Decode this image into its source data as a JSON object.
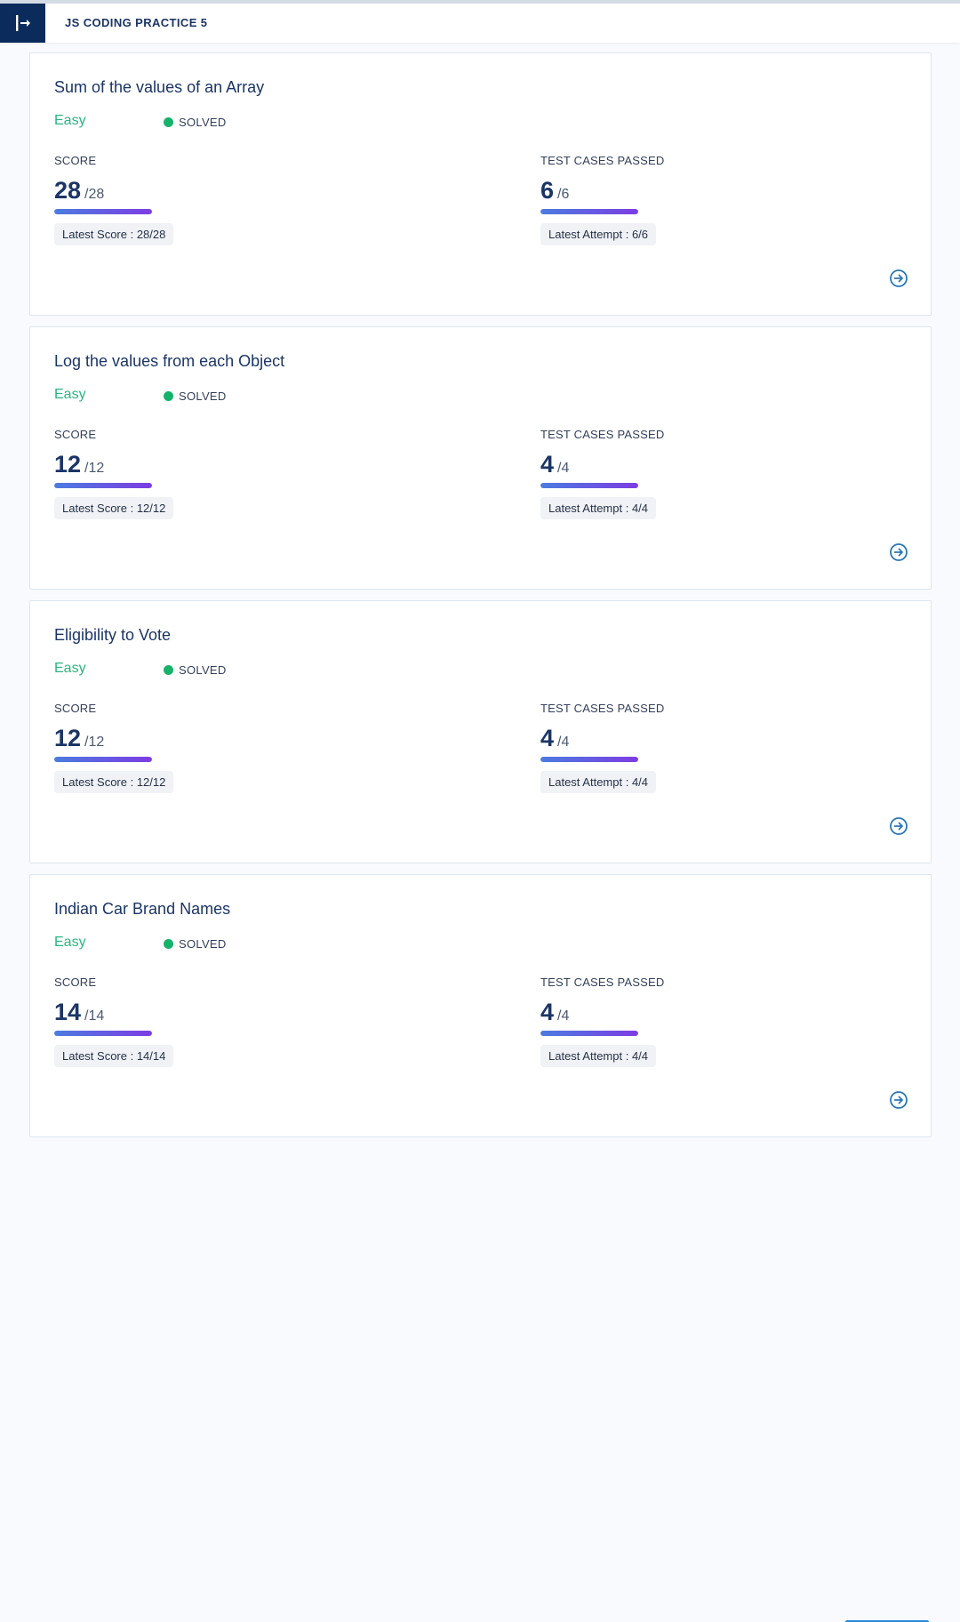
{
  "header": {
    "title": "JS CODING PRACTICE 5",
    "toggle_icon": "sidebar-expand-icon"
  },
  "colors": {
    "accent_dark": "#0b2b5c",
    "difficulty_easy": "#2bb57f",
    "solved_dot": "#17b26a",
    "progress_start": "#4b7ce0",
    "progress_end": "#7d3ce3",
    "link_icon": "#2a78b5"
  },
  "questions": [
    {
      "title": "Sum of the values of an Array",
      "difficulty": "Easy",
      "status": "SOLVED",
      "score_label": "SCORE",
      "score": "28",
      "score_total": "/28",
      "score_fraction": 1.0,
      "latest_score": "Latest Score : 28/28",
      "tests_label": "TEST CASES PASSED",
      "tests": "6",
      "tests_total": "/6",
      "tests_fraction": 1.0,
      "latest_attempt": "Latest Attempt : 6/6"
    },
    {
      "title": "Log the values from each Object",
      "difficulty": "Easy",
      "status": "SOLVED",
      "score_label": "SCORE",
      "score": "12",
      "score_total": "/12",
      "score_fraction": 1.0,
      "latest_score": "Latest Score : 12/12",
      "tests_label": "TEST CASES PASSED",
      "tests": "4",
      "tests_total": "/4",
      "tests_fraction": 1.0,
      "latest_attempt": "Latest Attempt : 4/4"
    },
    {
      "title": "Eligibility to Vote",
      "difficulty": "Easy",
      "status": "SOLVED",
      "score_label": "SCORE",
      "score": "12",
      "score_total": "/12",
      "score_fraction": 1.0,
      "latest_score": "Latest Score : 12/12",
      "tests_label": "TEST CASES PASSED",
      "tests": "4",
      "tests_total": "/4",
      "tests_fraction": 1.0,
      "latest_attempt": "Latest Attempt : 4/4"
    },
    {
      "title": "Indian Car Brand Names",
      "difficulty": "Easy",
      "status": "SOLVED",
      "score_label": "SCORE",
      "score": "14",
      "score_total": "/14",
      "score_fraction": 1.0,
      "latest_score": "Latest Score : 14/14",
      "tests_label": "TEST CASES PASSED",
      "tests": "4",
      "tests_total": "/4",
      "tests_fraction": 1.0,
      "latest_attempt": "Latest Attempt : 4/4"
    }
  ]
}
